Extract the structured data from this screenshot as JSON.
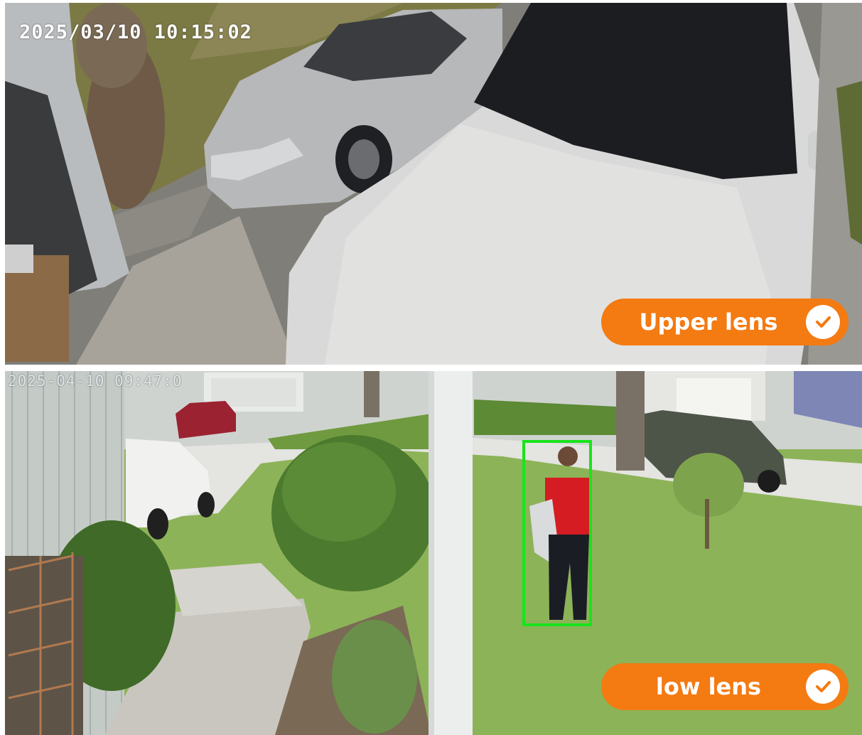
{
  "upper_view": {
    "timestamp": "2025/03/10 10:15:02",
    "badge_label": "Upper lens",
    "badge_icon": "check-icon"
  },
  "lower_view": {
    "timestamp": "2025-04-10 09:47:0",
    "badge_label": "low lens",
    "badge_icon": "check-icon",
    "detection": "person"
  },
  "colors": {
    "badge": "#f47a12",
    "detection_box": "#18e41b"
  }
}
